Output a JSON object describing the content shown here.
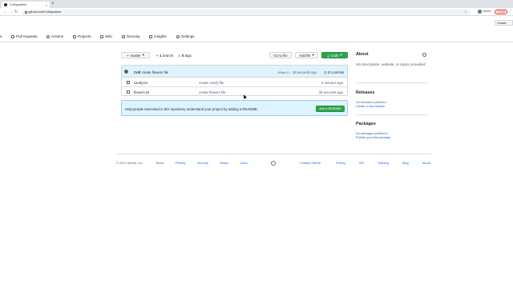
{
  "browser": {
    "tab_title": "Colt/quotime",
    "new_tab": "+",
    "tab_close": "×",
    "url": "github.com/Colt/quotime",
    "back": "←",
    "forward": "→",
    "reload": "↻",
    "star": "☆",
    "profile_label": "Guest",
    "update_label": "Update",
    "menu": "⋮"
  },
  "repo_actions": {
    "unwatch_label": "Unwatc"
  },
  "repo_nav": {
    "items": [
      {
        "label": "s"
      },
      {
        "label": "Pull requests"
      },
      {
        "label": "Actions"
      },
      {
        "label": "Projects"
      },
      {
        "label": "Wiki"
      },
      {
        "label": "Security"
      },
      {
        "label": "Insights"
      },
      {
        "label": "Settings"
      }
    ]
  },
  "file_nav": {
    "branch_label": "master",
    "branch_count": "1",
    "branch_word": "branch",
    "tag_count": "0",
    "tag_word": "tags",
    "goto_file": "Go to file",
    "add_file": "Add file",
    "code": "Code"
  },
  "latest_commit": {
    "author": "Colt",
    "message": "create flowers file",
    "sha": "f80bc11",
    "ago": "39 seconds ago",
    "commit_count": "2",
    "commit_word": "commits"
  },
  "files": [
    {
      "name": "candy.txt",
      "message": "create candy file",
      "time": "2 minutes ago"
    },
    {
      "name": "flowers.txt",
      "message": "create flowers file",
      "time": "39 seconds ago"
    }
  ],
  "readme_prompt": {
    "text": "Help people interested in this repository understand your project by adding a README.",
    "button": "Add a README"
  },
  "sidebar": {
    "about_heading": "About",
    "about_text": "No description, website, or topics provided.",
    "releases_heading": "Releases",
    "releases_text": "No releases published",
    "releases_link": "Create a new release",
    "packages_heading": "Packages",
    "packages_text": "No packages published",
    "packages_link": "Publish your first package"
  },
  "footer": {
    "copyright": "© 2021 GitHub, Inc.",
    "links": [
      "Terms",
      "Privacy",
      "Security",
      "Status",
      "Docs",
      "Contact GitHub",
      "Pricing",
      "API",
      "Training",
      "Blog",
      "About"
    ]
  },
  "colors": {
    "primary_green": "#2da44e",
    "link_blue": "#0969da",
    "commit_row_bg": "#ddf4ff"
  },
  "icons": [
    "shield-icon",
    "play-icon",
    "table-icon",
    "book-icon",
    "graph-icon",
    "gear-icon",
    "branch-icon",
    "tag-icon",
    "history-icon",
    "file-icon",
    "github-mark-icon"
  ]
}
